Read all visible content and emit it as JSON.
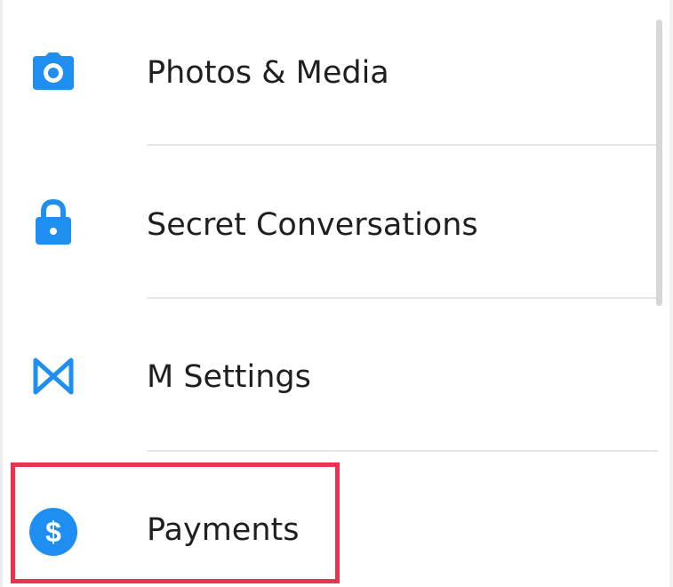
{
  "menu": {
    "items": [
      {
        "label": "Photos & Media",
        "icon": "camera-icon"
      },
      {
        "label": "Secret Conversations",
        "icon": "lock-icon"
      },
      {
        "label": "M Settings",
        "icon": "m-logo-icon"
      },
      {
        "label": "Payments",
        "icon": "dollar-circle-icon"
      }
    ]
  },
  "colors": {
    "accent": "#1f8ef1",
    "highlight": "#e8344f",
    "divider": "#e6e6e6",
    "text": "#1f1f1f"
  }
}
